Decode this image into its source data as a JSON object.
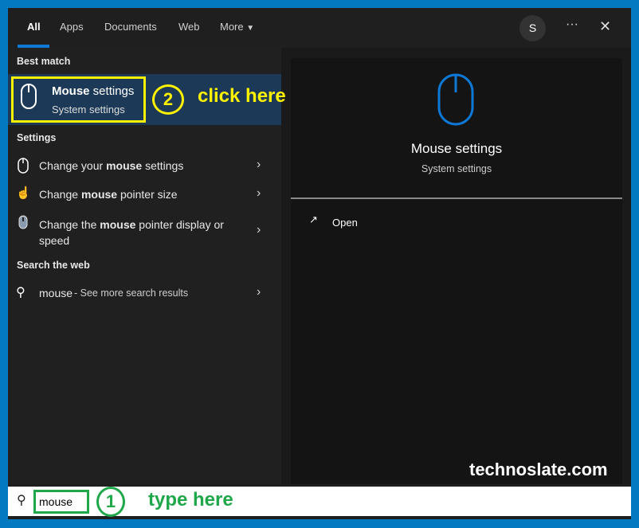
{
  "tabs": [
    "All",
    "Apps",
    "Documents",
    "Web",
    "More"
  ],
  "user_initial": "S",
  "more_options": "···",
  "close": "✕",
  "best_match": {
    "heading": "Best match",
    "title_bold": "Mouse",
    "title_rest": " settings",
    "subtitle": "System settings"
  },
  "settings": {
    "heading": "Settings",
    "items": [
      {
        "pre": "Change your ",
        "bold": "mouse",
        "post": " settings"
      },
      {
        "pre": "Change ",
        "bold": "mouse",
        "post": " pointer size"
      },
      {
        "pre": "Change the ",
        "bold": "mouse",
        "post": " pointer display or speed"
      }
    ]
  },
  "web": {
    "heading": "Search the web",
    "query": "mouse",
    "suffix": " - See more search results"
  },
  "preview": {
    "title": "Mouse settings",
    "subtitle": "System settings",
    "action": "Open"
  },
  "search": {
    "value": "mouse"
  },
  "annotations": {
    "step1": "1",
    "step1_text": "type here",
    "step2": "2",
    "step2_text": "click here",
    "watermark": "technoslate.com"
  },
  "colors": {
    "accent": "#0f78d4",
    "highlight": "#fff200",
    "annotation_green": "#1fa84a",
    "frame": "#0279c1"
  }
}
